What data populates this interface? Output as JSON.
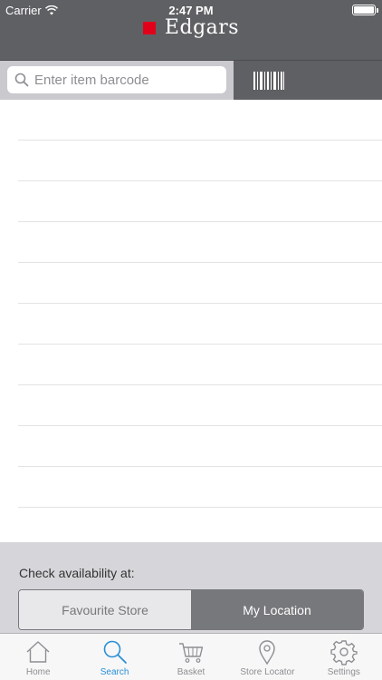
{
  "status_bar": {
    "carrier": "Carrier",
    "time": "2:47 PM",
    "battery_level": 1.0
  },
  "header": {
    "brand": "Edgars",
    "brand_color": "#e1001a"
  },
  "search": {
    "placeholder": "Enter item barcode",
    "value": ""
  },
  "results": {
    "row_count": 10
  },
  "availability": {
    "label": "Check availability at:",
    "options": [
      "Favourite Store",
      "My Location"
    ],
    "selected": "My Location"
  },
  "tabbar": {
    "active_color": "#2a8fd6",
    "items": [
      {
        "label": "Home",
        "icon": "home-icon"
      },
      {
        "label": "Search",
        "icon": "search-icon",
        "active": true
      },
      {
        "label": "Basket",
        "icon": "basket-icon"
      },
      {
        "label": "Store Locator",
        "icon": "map-pin-icon"
      },
      {
        "label": "Settings",
        "icon": "gear-icon"
      }
    ]
  }
}
